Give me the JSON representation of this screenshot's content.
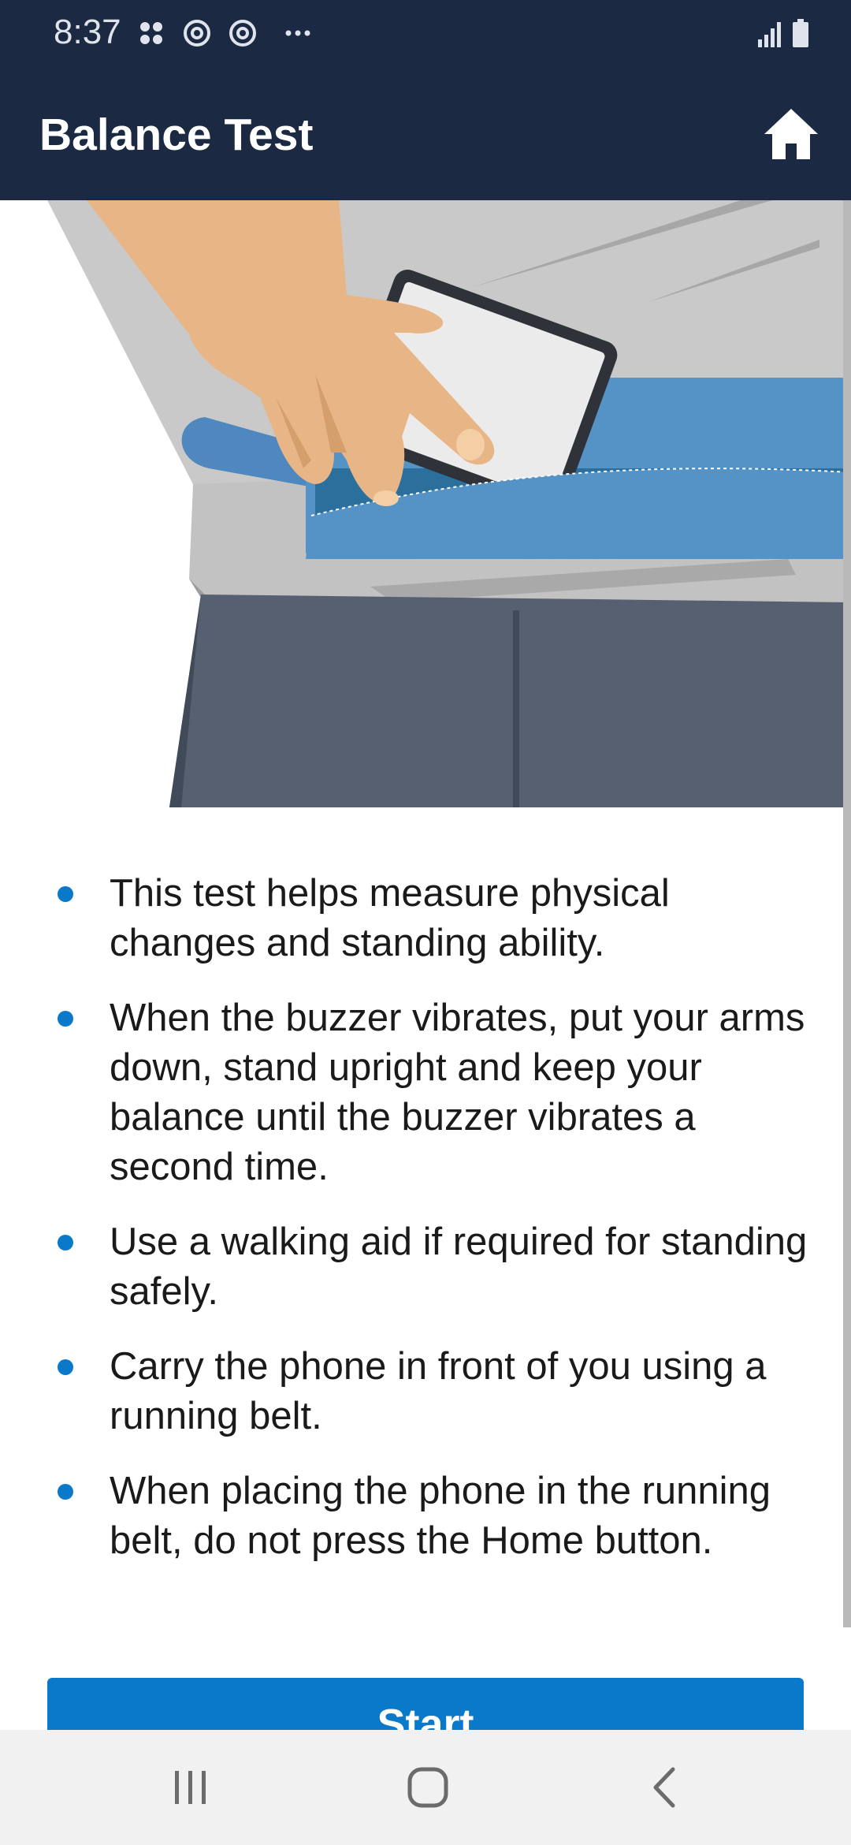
{
  "status_bar": {
    "time": "8:37",
    "left_icons": [
      "grid-dots-icon",
      "sync-circle-icon",
      "sync-circle-icon",
      "more-dots-icon"
    ],
    "right_icons": [
      "signal-icon",
      "battery-icon"
    ]
  },
  "app_bar": {
    "title": "Balance Test",
    "home_icon": "home-icon",
    "background": "#1b2a42"
  },
  "hero": {
    "image_description_icon": "phone-in-running-belt-illustration"
  },
  "instructions": [
    "This test helps measure physical changes and standing ability.",
    "When the buzzer vibrates, put your arms down, stand upright and keep your balance until the buzzer vibrates a second time.",
    "Use a walking aid if required for standing safely.",
    "Carry the phone in front of you using a running belt.",
    "When placing the phone in the running belt, do not press the Home button."
  ],
  "start_button": {
    "label": "Start",
    "color": "#0b79c9"
  },
  "nav_bar": {
    "icons": [
      "recent-apps-icon",
      "home-circle-icon",
      "back-icon"
    ]
  }
}
